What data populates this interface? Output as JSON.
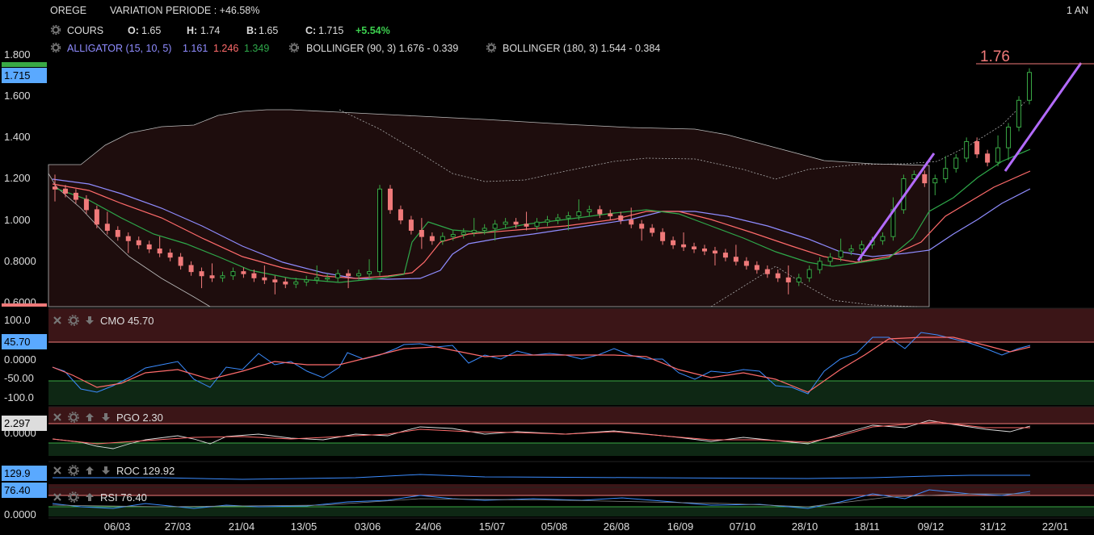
{
  "header": {
    "ticker": "OREGE",
    "variation": "VARIATION PERIODE : +46.58%",
    "period": "1 AN",
    "cours_label": "COURS",
    "open_label": "O:",
    "open": "1.65",
    "high_label": "H:",
    "high": "1.74",
    "low_label": "B:",
    "low": "1.65",
    "close_label": "C:",
    "close": "1.715",
    "change": "+5.54%",
    "alligator_label": "ALLIGATOR (15, 10, 5)",
    "alligator_v1": "1.161",
    "alligator_v2": "1.246",
    "alligator_v3": "1.349",
    "boll90": "BOLLINGER (90, 3) 1.676 - 0.339",
    "boll180": "BOLLINGER (180, 3) 1.544 - 0.384"
  },
  "colors": {
    "up": "#39a845",
    "down": "#f07a7a",
    "alligator_blue": "#8f8cff",
    "alligator_red": "#ff6b6b",
    "alligator_green": "#2ea84a",
    "trendline": "#b36bff",
    "panel_red": "#3b1517",
    "panel_green": "#0e2714"
  },
  "price_axis": {
    "ticks": [
      "1.800",
      "1.600",
      "1.400",
      "1.200",
      "1.000",
      "0.8000",
      "0.6000"
    ],
    "last_badge": "1.715",
    "target_label": "1.76"
  },
  "x_axis": {
    "ticks": [
      "06/03",
      "27/03",
      "21/04",
      "13/05",
      "03/06",
      "24/06",
      "15/07",
      "05/08",
      "26/08",
      "16/09",
      "07/10",
      "28/10",
      "18/11",
      "09/12",
      "31/12",
      "22/01"
    ]
  },
  "cmo": {
    "title": "CMO 45.70",
    "badge": "45.70",
    "ticks": [
      "100.0",
      "0.0000",
      "-50.00",
      "-100.0"
    ]
  },
  "pgo": {
    "title": "PGO 2.30",
    "badge": "2.297",
    "ticks": [
      "0.0000"
    ]
  },
  "roc": {
    "title": "ROC 129.92",
    "badge": "129.9"
  },
  "rsi": {
    "title": "RSI 76.40",
    "badge": "76.40",
    "ticks": [
      "0.0000"
    ]
  },
  "chart_data": {
    "type": "candlestick",
    "ylim": [
      0.6,
      1.8
    ],
    "series_close_approx": [
      1.15,
      1.13,
      1.1,
      1.05,
      0.98,
      0.95,
      0.92,
      0.9,
      0.88,
      0.86,
      0.84,
      0.82,
      0.78,
      0.75,
      0.73,
      0.72,
      0.73,
      0.75,
      0.74,
      0.72,
      0.71,
      0.7,
      0.69,
      0.7,
      0.71,
      0.72,
      0.72,
      0.74,
      0.73,
      0.74,
      0.75,
      1.15,
      1.05,
      1.0,
      0.95,
      0.92,
      0.9,
      0.92,
      0.93,
      0.94,
      0.95,
      0.96,
      0.98,
      0.99,
      0.98,
      0.97,
      0.99,
      1.0,
      1.01,
      1.02,
      1.04,
      1.05,
      1.03,
      1.02,
      1.0,
      0.98,
      0.96,
      0.94,
      0.9,
      0.88,
      0.87,
      0.86,
      0.85,
      0.84,
      0.82,
      0.8,
      0.78,
      0.76,
      0.74,
      0.72,
      0.7,
      0.72,
      0.76,
      0.8,
      0.82,
      0.85,
      0.86,
      0.88,
      0.9,
      0.92,
      1.05,
      1.2,
      1.22,
      1.18,
      1.2,
      1.25,
      1.3,
      1.38,
      1.32,
      1.28,
      1.35,
      1.45,
      1.58,
      1.715
    ]
  }
}
